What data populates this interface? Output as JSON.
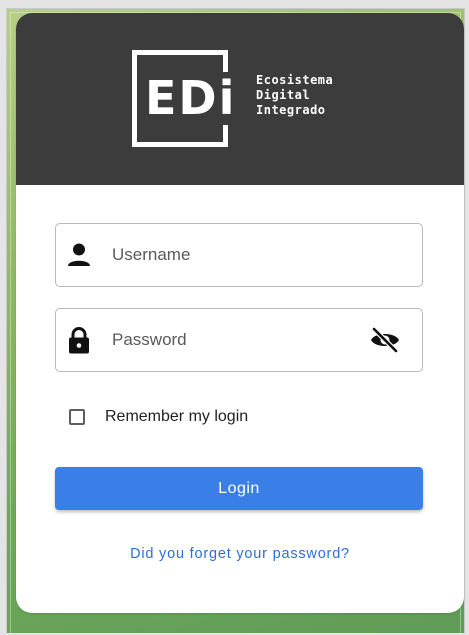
{
  "logo": {
    "letters": "EDi",
    "tagline": [
      "Ecosistema",
      "Digital",
      "Integrado"
    ]
  },
  "form": {
    "username_placeholder": "Username",
    "username_value": "",
    "password_placeholder": "Password",
    "password_value": "",
    "remember_label": "Remember my login",
    "remember_checked": false,
    "login_label": "Login",
    "forgot_label": "Did you forget your password?"
  },
  "icons": {
    "username": "person-icon",
    "password": "lock-icon",
    "toggle_password": "eye-off-icon"
  },
  "colors": {
    "header_bg": "#3c3c3c",
    "primary": "#3a7ee8",
    "link": "#2f6fd0",
    "background_green": "#8fb865"
  }
}
